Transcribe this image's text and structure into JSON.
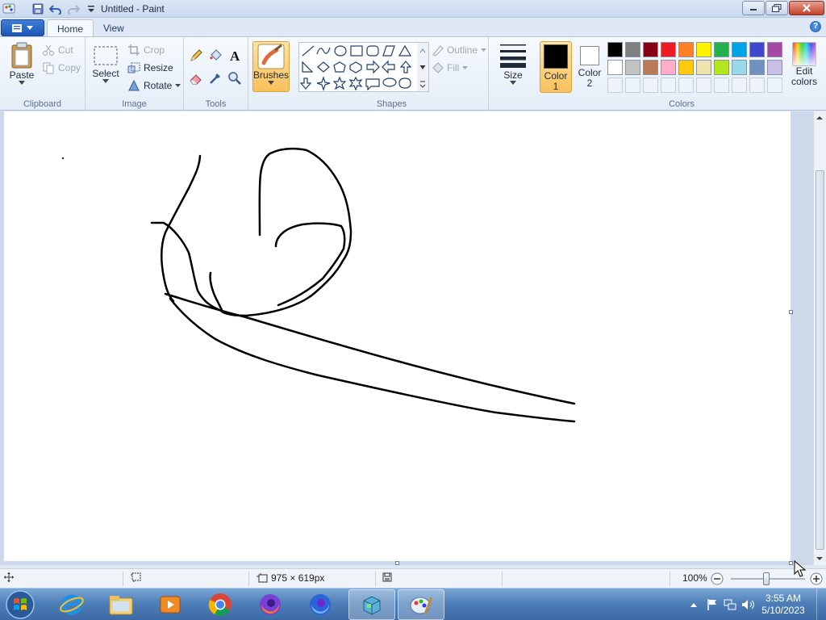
{
  "window": {
    "title": "Untitled - Paint"
  },
  "tabs": {
    "home": "Home",
    "view": "View"
  },
  "clipboard": {
    "paste": "Paste",
    "cut": "Cut",
    "copy": "Copy",
    "label": "Clipboard"
  },
  "image": {
    "select": "Select",
    "crop": "Crop",
    "resize": "Resize",
    "rotate": "Rotate",
    "label": "Image"
  },
  "tools": {
    "label": "Tools"
  },
  "brushes": {
    "label": "Brushes"
  },
  "shapes": {
    "outline": "Outline",
    "fill": "Fill",
    "label": "Shapes"
  },
  "size": {
    "label": "Size"
  },
  "colors": {
    "color1_label": "Color 1",
    "color2_label": "Color 2",
    "edit_label": "Edit colors",
    "group_label": "Colors",
    "color1": "#000000",
    "color2": "#ffffff",
    "palette_row1": [
      "#000000",
      "#7f7f7f",
      "#880015",
      "#ed1c24",
      "#ff7f27",
      "#fff200",
      "#22b14c",
      "#00a2e8",
      "#3f48cc",
      "#a349a4"
    ],
    "palette_row2": [
      "#ffffff",
      "#c3c3c3",
      "#b97a57",
      "#ffaec9",
      "#ffc90e",
      "#efe4b0",
      "#b5e61d",
      "#99d9ea",
      "#7092be",
      "#c8bfe7"
    ]
  },
  "status": {
    "canvas_size": "975 × 619px",
    "zoom": "100%"
  },
  "taskbar": {
    "time": "3:55 AM",
    "date": "5/10/2023",
    "apps": [
      "internet-explorer",
      "file-explorer",
      "media-player",
      "chrome",
      "firefox",
      "firefox-dev",
      "package-app",
      "paint"
    ]
  }
}
